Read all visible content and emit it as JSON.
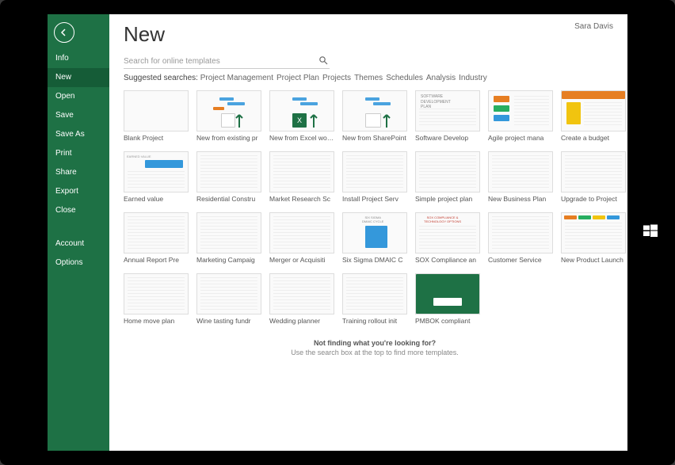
{
  "user": "Sara Davis",
  "title": "New",
  "sidebar": {
    "items": [
      {
        "label": "Info"
      },
      {
        "label": "New",
        "active": true
      },
      {
        "label": "Open"
      },
      {
        "label": "Save"
      },
      {
        "label": "Save As"
      },
      {
        "label": "Print"
      },
      {
        "label": "Share"
      },
      {
        "label": "Export"
      },
      {
        "label": "Close"
      }
    ],
    "items2": [
      {
        "label": "Account"
      },
      {
        "label": "Options"
      }
    ]
  },
  "search": {
    "placeholder": "Search for online templates"
  },
  "suggest": {
    "label": "Suggested searches:",
    "links": [
      "Project Management",
      "Project Plan",
      "Projects",
      "Themes",
      "Schedules",
      "Analysis",
      "Industry"
    ]
  },
  "templates": [
    {
      "label": "Blank Project",
      "kind": "blank"
    },
    {
      "label": "New from existing pr",
      "kind": "gantt-green"
    },
    {
      "label": "New from Excel workb",
      "kind": "excel"
    },
    {
      "label": "New from SharePoint",
      "kind": "sharepoint"
    },
    {
      "label": "Software Develop",
      "kind": "text"
    },
    {
      "label": "Agile project mana",
      "kind": "agile"
    },
    {
      "label": "Create a budget",
      "kind": "budget"
    },
    {
      "label": "Earned value",
      "kind": "earned"
    },
    {
      "label": "Residential Constru",
      "kind": "sheet"
    },
    {
      "label": "Market Research Sc",
      "kind": "sheet"
    },
    {
      "label": "Install Project Serv",
      "kind": "sheet"
    },
    {
      "label": "Simple project plan",
      "kind": "sheet"
    },
    {
      "label": "New Business Plan",
      "kind": "sheet"
    },
    {
      "label": "Upgrade to Project",
      "kind": "sheet"
    },
    {
      "label": "Annual Report Pre",
      "kind": "sheet"
    },
    {
      "label": "Marketing Campaig",
      "kind": "sheet"
    },
    {
      "label": "Merger or Acquisiti",
      "kind": "sheet"
    },
    {
      "label": "Six Sigma DMAIC C",
      "kind": "sixsigma"
    },
    {
      "label": "SOX Compliance an",
      "kind": "sox"
    },
    {
      "label": "Customer Service",
      "kind": "sheet"
    },
    {
      "label": "New Product Launch",
      "kind": "launch"
    },
    {
      "label": "Home move plan",
      "kind": "sheet"
    },
    {
      "label": "Wine tasting fundr",
      "kind": "sheet"
    },
    {
      "label": "Wedding planner",
      "kind": "sheet"
    },
    {
      "label": "Training rollout init",
      "kind": "sheet"
    },
    {
      "label": "PMBOK compliant",
      "kind": "pmbok"
    }
  ],
  "footer": {
    "line1": "Not finding what you're looking for?",
    "line2": "Use the search box at the top to find more templates."
  }
}
